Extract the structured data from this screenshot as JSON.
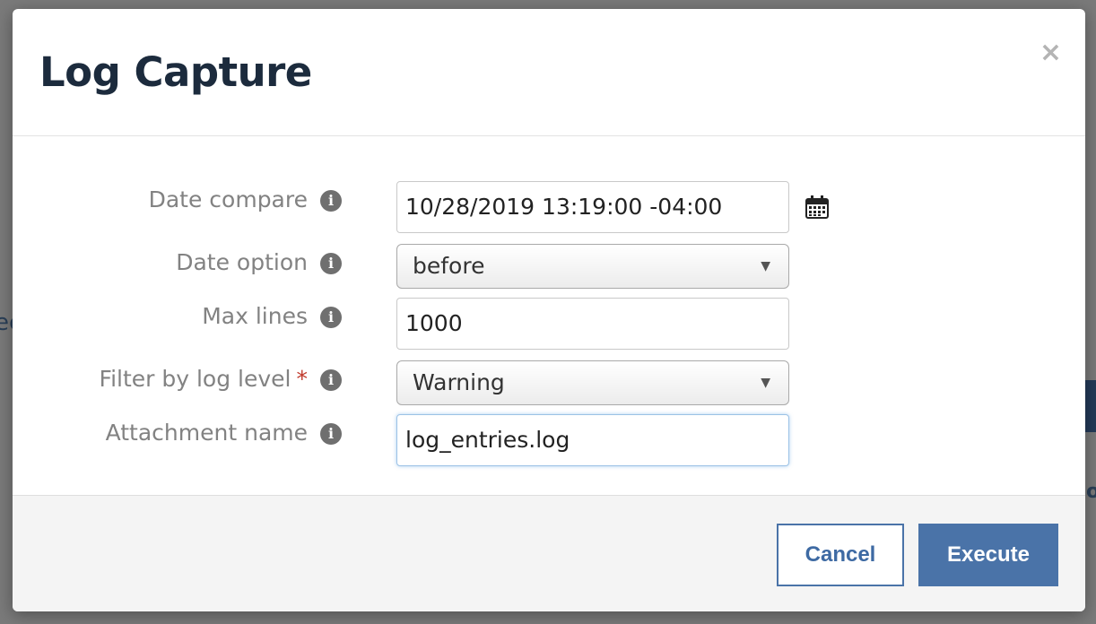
{
  "background": {
    "left_fragment": "ec",
    "right_fragment": "o"
  },
  "modal": {
    "title": "Log Capture",
    "close_symbol": "×"
  },
  "form": {
    "fields": [
      {
        "label": "Date compare",
        "value": "10/28/2019 13:19:00 -04:00",
        "type": "date",
        "info": "i"
      },
      {
        "label": "Date option",
        "value": "before",
        "type": "select",
        "info": "i"
      },
      {
        "label": "Max lines",
        "value": "1000",
        "type": "text",
        "info": "i"
      },
      {
        "label": "Filter by log level",
        "required_mark": "*",
        "value": "Warning",
        "type": "select",
        "info": "i"
      },
      {
        "label": "Attachment name",
        "value": "log_entries.log",
        "type": "text",
        "info": "i"
      }
    ],
    "select_arrow": "▼"
  },
  "footer": {
    "cancel_label": "Cancel",
    "execute_label": "Execute"
  },
  "colors": {
    "accent": "#4a73a8",
    "title": "#1c2b3d",
    "required": "#c0392b"
  },
  "icons": [
    "info-icon",
    "calendar-icon",
    "close-icon",
    "chevron-down-icon"
  ]
}
